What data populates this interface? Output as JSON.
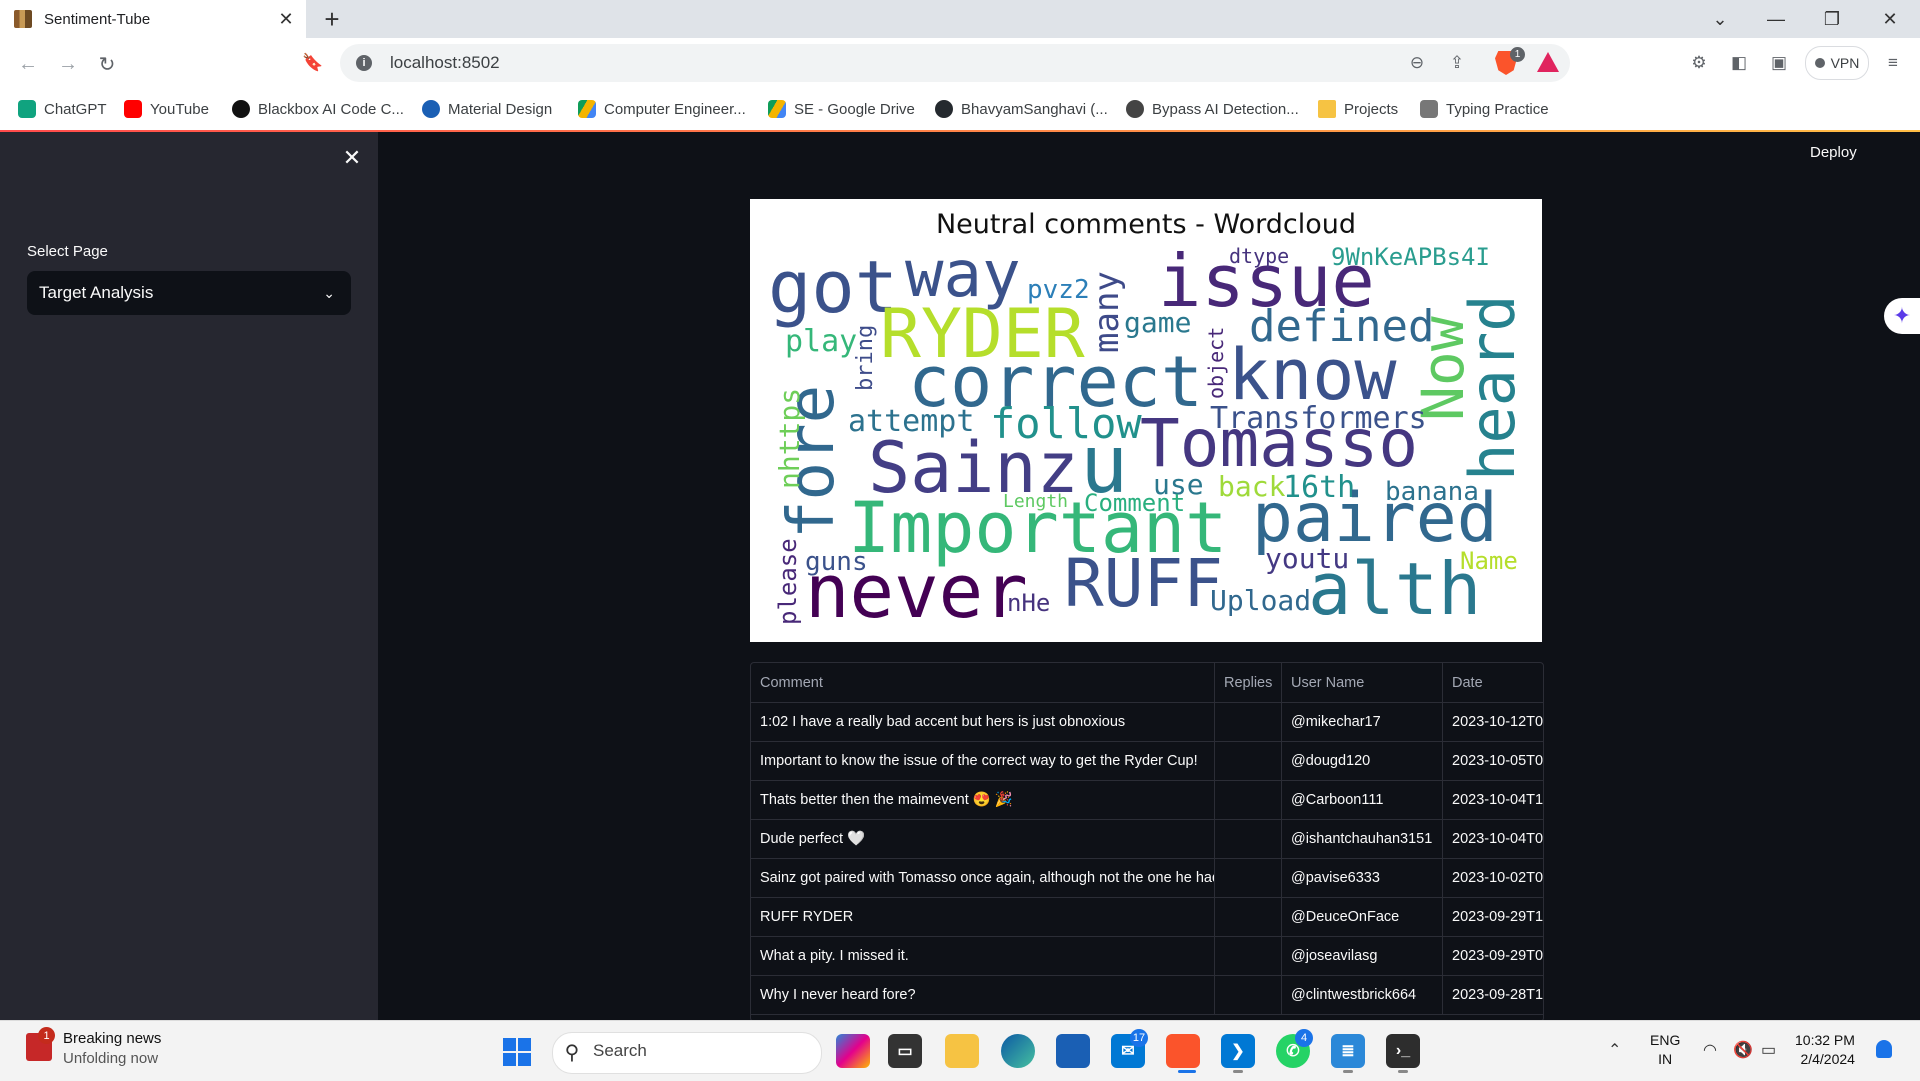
{
  "browser": {
    "tab_title": "Sentiment-Tube",
    "url": "localhost:8502",
    "vpn_label": "VPN",
    "brave_badge": "1",
    "bookmarks": [
      {
        "label": "ChatGPT",
        "color": "#10a37f"
      },
      {
        "label": "YouTube",
        "color": "#ff0000"
      },
      {
        "label": "Blackbox AI Code C...",
        "color": "#111111"
      },
      {
        "label": "Material Design",
        "color": "#1a5fb4"
      },
      {
        "label": "Computer Engineer...",
        "color": "#f4b400"
      },
      {
        "label": "SE - Google Drive",
        "color": "#0f9d58"
      },
      {
        "label": "BhavyamSanghavi (...",
        "color": "#24292e"
      },
      {
        "label": "Bypass AI Detection...",
        "color": "#444444"
      },
      {
        "label": "Projects",
        "color": "#f6c343"
      },
      {
        "label": "Typing Practice",
        "color": "#777777"
      }
    ]
  },
  "sidebar": {
    "select_label": "Select Page",
    "selected_page": "Target Analysis"
  },
  "header": {
    "deploy_label": "Deploy"
  },
  "wordcloud": {
    "title": "Neutral comments - Wordcloud",
    "words": [
      {
        "text": "got",
        "color": "#3b528b"
      },
      {
        "text": "way",
        "color": "#3b528b"
      },
      {
        "text": "issue",
        "color": "#482878"
      },
      {
        "text": "dtype",
        "color": "#46337e"
      },
      {
        "text": "9WnKeAPBs4I",
        "color": "#2a9d8f"
      },
      {
        "text": "pvz2",
        "color": "#2c7fb8"
      },
      {
        "text": "RYDER",
        "color": "#b5de2b"
      },
      {
        "text": "many",
        "color": "#3e4a89"
      },
      {
        "text": "game",
        "color": "#2a788e"
      },
      {
        "text": "defined",
        "color": "#31688e"
      },
      {
        "text": "play",
        "color": "#35b779"
      },
      {
        "text": "bring",
        "color": "#3e4c8a"
      },
      {
        "text": "correct",
        "color": "#31688e"
      },
      {
        "text": "know",
        "color": "#3b528b"
      },
      {
        "text": "Now",
        "color": "#5ec962"
      },
      {
        "text": "heard",
        "color": "#26828e"
      },
      {
        "text": "object",
        "color": "#482878"
      },
      {
        "text": "fore",
        "color": "#31688e"
      },
      {
        "text": "attempt",
        "color": "#2c728e"
      },
      {
        "text": "follow",
        "color": "#21918c"
      },
      {
        "text": "Transformers",
        "color": "#3b528b"
      },
      {
        "text": "Tomasso",
        "color": "#453781"
      },
      {
        "text": "nhttps",
        "color": "#6ece58"
      },
      {
        "text": "Sainz",
        "color": "#433e85"
      },
      {
        "text": "u",
        "color": "#2a788e"
      },
      {
        "text": "use",
        "color": "#2a788e"
      },
      {
        "text": "back",
        "color": "#9fda3a"
      },
      {
        "text": "16th",
        "color": "#21918c"
      },
      {
        "text": "banana",
        "color": "#2c728e"
      },
      {
        "text": "Length",
        "color": "#5ec962"
      },
      {
        "text": "Comment",
        "color": "#29af7f"
      },
      {
        "text": "Important",
        "color": "#35b779"
      },
      {
        "text": "paired",
        "color": "#31688e"
      },
      {
        "text": "please",
        "color": "#482878"
      },
      {
        "text": "guns",
        "color": "#3b528b"
      },
      {
        "text": "youtu",
        "color": "#443983"
      },
      {
        "text": "Name",
        "color": "#b5de2b"
      },
      {
        "text": "never",
        "color": "#440154"
      },
      {
        "text": "nHe",
        "color": "#46337e"
      },
      {
        "text": "RUFF",
        "color": "#3b528b"
      },
      {
        "text": "Upload",
        "color": "#31688e"
      },
      {
        "text": "alth",
        "color": "#2a788e"
      }
    ]
  },
  "table": {
    "columns": [
      "Comment",
      "Replies",
      "User Name",
      "Date"
    ],
    "rows": [
      {
        "comment": "1:02 I have a really bad accent but hers is just obnoxious",
        "replies": "",
        "user": "@mikechar17",
        "date": "2023-10-12T0"
      },
      {
        "comment": "Important to know the issue of the correct way to get the Ryder Cup!",
        "replies": "",
        "user": "@dougd120",
        "date": "2023-10-05T0"
      },
      {
        "comment": "Thats better then the maimevent 😍 🎉",
        "replies": "",
        "user": "@Carboon111",
        "date": "2023-10-04T1"
      },
      {
        "comment": "Dude perfect 🤍",
        "replies": "",
        "user": "@ishantchauhan3151",
        "date": "2023-10-04T0"
      },
      {
        "comment": "Sainz got paired with Tomasso once again, although not the one he had",
        "replies": "",
        "user": "@pavise6333",
        "date": "2023-10-02T0"
      },
      {
        "comment": "RUFF RYDER",
        "replies": "",
        "user": "@DeuceOnFace",
        "date": "2023-09-29T1"
      },
      {
        "comment": "What a pity. I missed it.",
        "replies": "",
        "user": "@joseavilasg",
        "date": "2023-09-29T0"
      },
      {
        "comment": "Why I never heard fore?",
        "replies": "",
        "user": "@clintwestbrick664",
        "date": "2023-09-28T1"
      }
    ]
  },
  "taskbar": {
    "news_title": "Breaking news",
    "news_subtitle": "Unfolding now",
    "news_badge": "1",
    "search_placeholder": "Search",
    "badge_mail": "17",
    "badge_whatsapp": "4",
    "lang_line1": "ENG",
    "lang_line2": "IN",
    "time": "10:32 PM",
    "date": "2/4/2024"
  }
}
